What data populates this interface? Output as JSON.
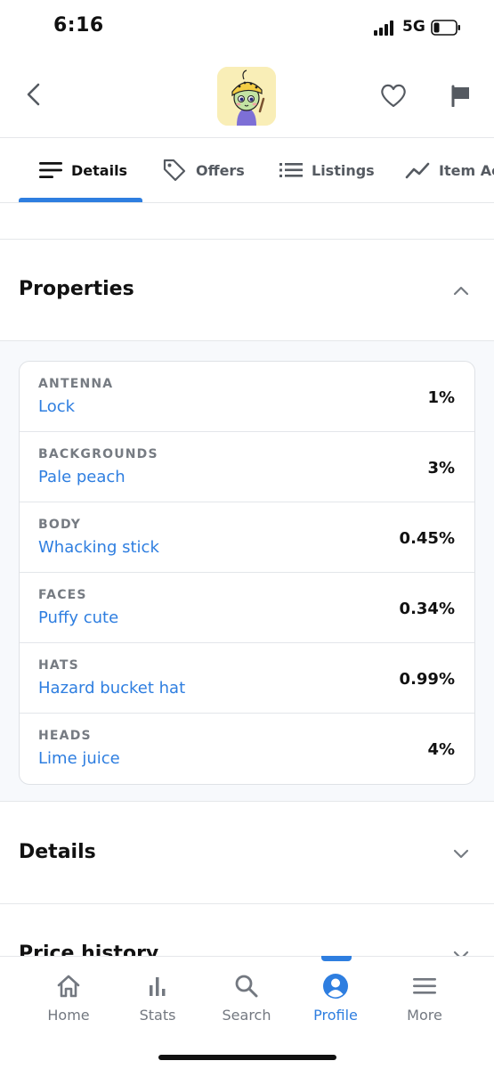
{
  "status_bar": {
    "time": "6:16",
    "network": "5G"
  },
  "header": {
    "back_icon": "chevron-left-icon",
    "favorite_icon": "heart-outline-icon",
    "report_icon": "flag-icon"
  },
  "tabs": [
    {
      "label": "Details",
      "icon": "details-lines-icon",
      "active": true
    },
    {
      "label": "Offers",
      "icon": "tag-icon",
      "active": false
    },
    {
      "label": "Listings",
      "icon": "list-icon",
      "active": false
    },
    {
      "label": "Item Ac",
      "icon": "trend-line-icon",
      "active": false
    }
  ],
  "properties": {
    "title": "Properties",
    "expanded": true,
    "items": [
      {
        "type": "ANTENNA",
        "value": "Lock",
        "rarity": "1%"
      },
      {
        "type": "BACKGROUNDS",
        "value": "Pale peach",
        "rarity": "3%"
      },
      {
        "type": "BODY",
        "value": "Whacking stick",
        "rarity": "0.45%"
      },
      {
        "type": "FACES",
        "value": "Puffy cute",
        "rarity": "0.34%"
      },
      {
        "type": "HATS",
        "value": "Hazard bucket hat",
        "rarity": "0.99%"
      },
      {
        "type": "HEADS",
        "value": "Lime juice",
        "rarity": "4%"
      }
    ]
  },
  "details": {
    "title": "Details",
    "expanded": false
  },
  "price_history": {
    "title": "Price history",
    "expanded": false
  },
  "bottom_nav": [
    {
      "label": "Home",
      "icon": "home-icon",
      "active": false
    },
    {
      "label": "Stats",
      "icon": "bar-chart-icon",
      "active": false
    },
    {
      "label": "Search",
      "icon": "search-icon",
      "active": false
    },
    {
      "label": "Profile",
      "icon": "profile-icon",
      "active": true
    },
    {
      "label": "More",
      "icon": "menu-icon",
      "active": false
    }
  ],
  "colors": {
    "accent": "#2e7ee0",
    "text_primary": "#111111",
    "text_muted": "#767b82",
    "avatar_bg": "#f9eeb7",
    "panel_bg": "#f7f9fc"
  }
}
